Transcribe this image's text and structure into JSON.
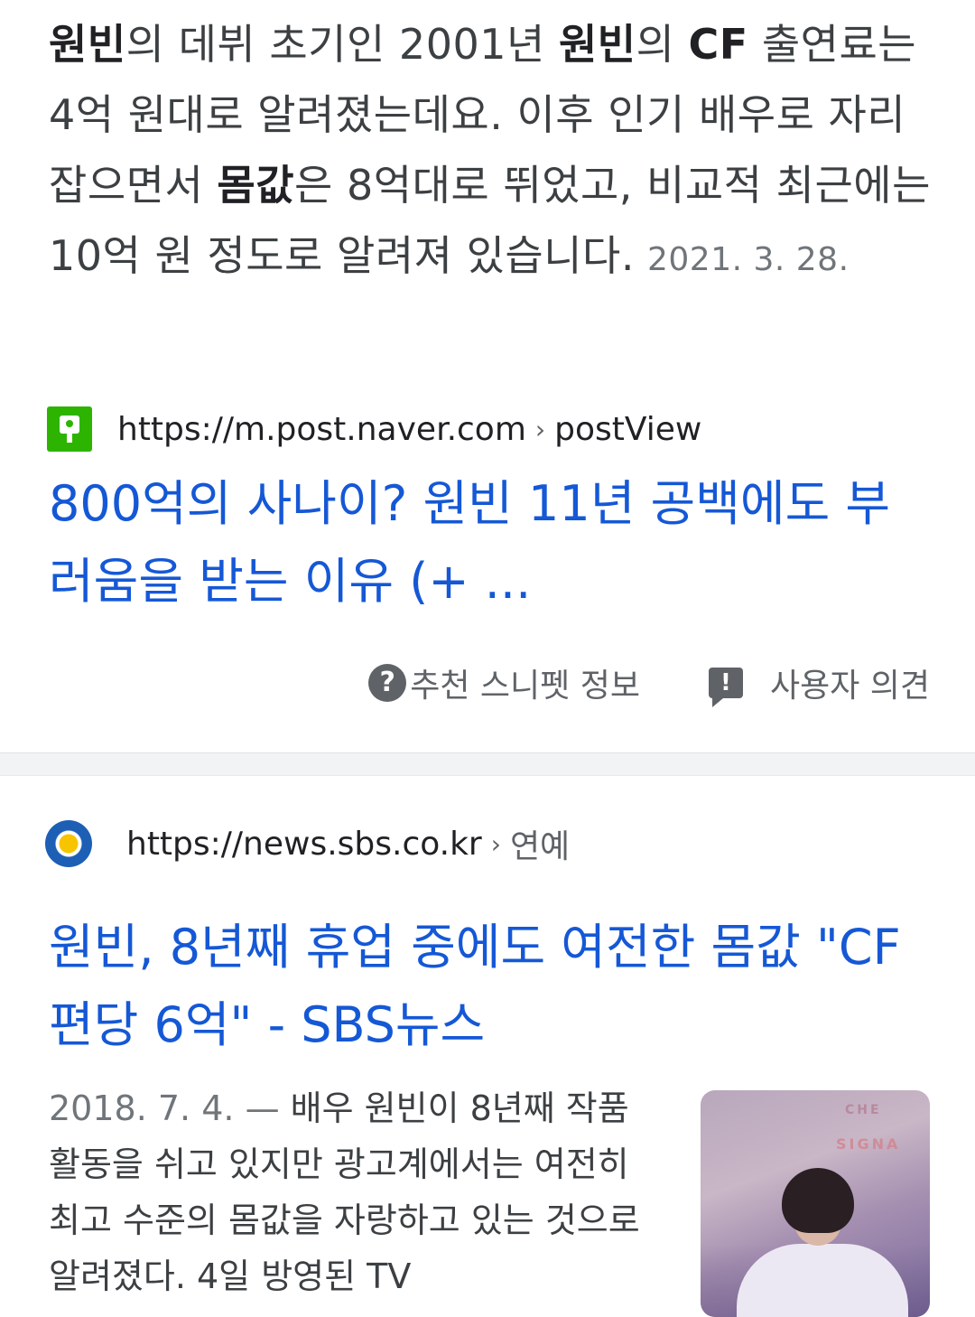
{
  "snippet": {
    "segments": [
      {
        "text": "원빈",
        "bold": true
      },
      {
        "text": "의 데뷔 초기인 2001년 ",
        "bold": false
      },
      {
        "text": "원빈",
        "bold": true
      },
      {
        "text": "의 ",
        "bold": false
      },
      {
        "text": "CF",
        "bold": true
      },
      {
        "text": " 출연료는 4억 원대로 알려졌는데요. 이후 인기 배우로 자리 잡으면서 ",
        "bold": false
      },
      {
        "text": "몸값",
        "bold": true
      },
      {
        "text": "은 8억대로 뛰었고, 비교적 최근에는 10억 원 정도로 알려져 있습니다.",
        "bold": false
      }
    ],
    "date": "2021. 3. 28."
  },
  "result1": {
    "url": "https://m.post.naver.com",
    "crumb_sep": "›",
    "crumb": "postView",
    "title": "800억의 사나이? 원빈 11년 공백에도 부러움을 받는 이유 (+ ..."
  },
  "actions": {
    "help_icon_glyph": "?",
    "recommend_label": "추천 스니펫 정보",
    "feedback_icon_glyph": "!",
    "feedback_label": "사용자 의견"
  },
  "result2": {
    "url": "https://news.sbs.co.kr",
    "crumb_sep": "›",
    "crumb": "연예",
    "title": "원빈, 8년째 휴업 중에도 여전한 몸값 \"CF 편당 6억\" - SBS뉴스",
    "date": "2018. 7. 4.",
    "dash": "—",
    "description": "배우 원빈이 8년째 작품 활동을 쉬고 있지만 광고계에서는 여전히 최고 수준의 몸값을 자랑하고 있는 것으로 알려졌다. 4일 방영된 TV",
    "thumb_text_top": "CHE",
    "thumb_text": "SIGNA"
  },
  "colors": {
    "link": "#1558d6",
    "naver_green": "#2db400",
    "sbs_blue": "#1d5fb5",
    "sbs_yellow": "#f7c400"
  }
}
